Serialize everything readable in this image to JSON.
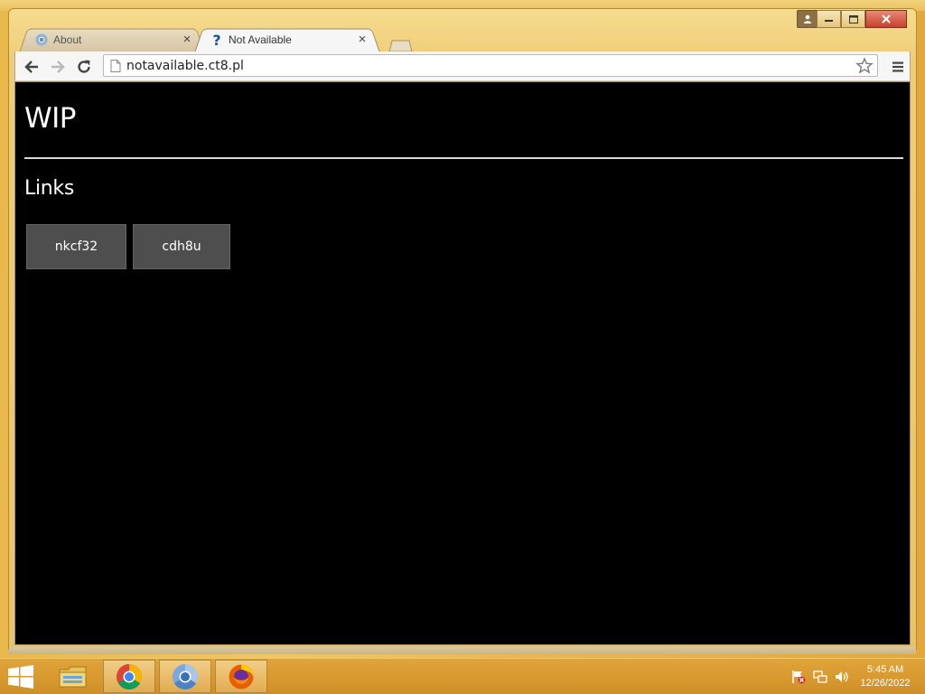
{
  "browser": {
    "tabs": [
      {
        "title": "About",
        "active": false
      },
      {
        "title": "Not Available",
        "active": true
      }
    ],
    "address": "notavailable.ct8.pl"
  },
  "page": {
    "heading": "WIP",
    "section_heading": "Links",
    "links": [
      {
        "label": "nkcf32"
      },
      {
        "label": "cdh8u"
      }
    ]
  },
  "taskbar": {
    "time": "5:45 AM",
    "date": "12/26/2022",
    "apps": [
      "file-explorer",
      "chrome",
      "chromium",
      "firefox"
    ]
  },
  "colors": {
    "page_background": "#000000",
    "link_button": "#4e4e4e",
    "taskbar": "#d99a30"
  }
}
